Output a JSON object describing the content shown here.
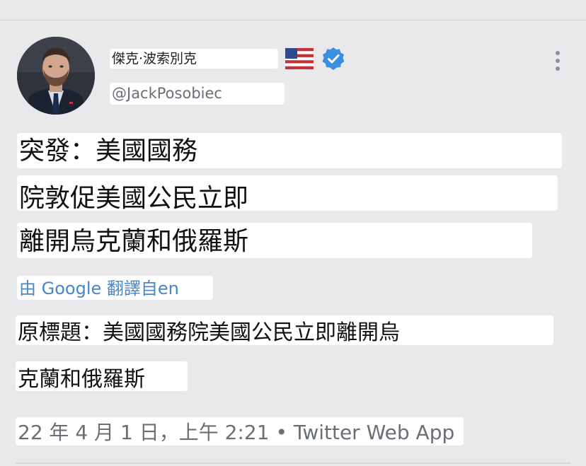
{
  "author": {
    "display_name": "傑克·波索別克",
    "handle": "@JackPosobiec",
    "flag_icon": "us-flag-icon",
    "verified_icon": "verified-badge-icon"
  },
  "tweet": {
    "lines": [
      "突發：美國國務",
      "院敦促美國公民立即",
      "離開烏克蘭和俄羅斯"
    ],
    "translate_label": "由 Google 翻譯自en",
    "original_title_lines": [
      "原標題：美國國務院美國公民立即離開烏",
      "克蘭和俄羅斯"
    ],
    "timestamp": "22 年 4 月 1 日，上午 2:21 • Twitter Web App"
  },
  "colors": {
    "background": "#e9e9eb",
    "highlight": "#ffffff",
    "link_blue": "#4a86c5",
    "verified_blue": "#1d9bf0",
    "secondary_text": "#6a6f75"
  },
  "menu": {
    "more_icon": "more-vertical-icon"
  }
}
